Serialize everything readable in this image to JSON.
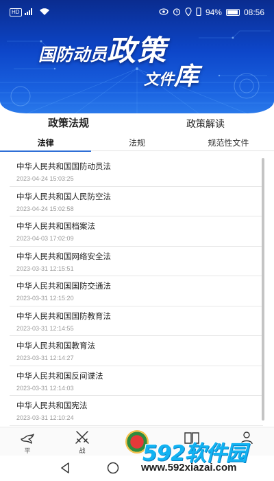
{
  "status_bar": {
    "network_left": "HD 4G",
    "battery": "94%",
    "time": "08:56"
  },
  "banner": {
    "title_line1_small": "国防动员",
    "title_line1_big": "政策",
    "title_line2_small": "文件",
    "title_line2_big": "库"
  },
  "main_tabs": [
    {
      "label": "政策法规",
      "active": true
    },
    {
      "label": "政策解读",
      "active": false
    }
  ],
  "sub_tabs": [
    {
      "label": "法律",
      "active": true
    },
    {
      "label": "法规",
      "active": false
    },
    {
      "label": "规范性文件",
      "active": false
    }
  ],
  "items": [
    {
      "title": "中华人民共和国国防动员法",
      "time": "2023-04-24 15:03:25"
    },
    {
      "title": "中华人民共和国人民防空法",
      "time": "2023-04-24 15:02:58"
    },
    {
      "title": "中华人民共和国档案法",
      "time": "2023-04-03 17:02:09"
    },
    {
      "title": "中华人民共和国网络安全法",
      "time": "2023-03-31 12:15:51"
    },
    {
      "title": "中华人民共和国国防交通法",
      "time": "2023-03-31 12:15:20"
    },
    {
      "title": "中华人民共和国国防教育法",
      "time": "2023-03-31 12:14:55"
    },
    {
      "title": "中华人民共和国教育法",
      "time": "2023-03-31 12:14:27"
    },
    {
      "title": "中华人民共和国反间谍法",
      "time": "2023-03-31 12:14:03"
    },
    {
      "title": "中华人民共和国宪法",
      "time": "2023-03-31 12:10:24"
    }
  ],
  "bottom_nav": [
    {
      "label": "平",
      "icon": "dove-icon"
    },
    {
      "label": "战",
      "icon": "crossed-swords-icon"
    },
    {
      "label": "",
      "icon": "emblem-icon"
    },
    {
      "label": "",
      "icon": "book-icon"
    },
    {
      "label": "",
      "icon": "user-icon"
    }
  ],
  "watermark": {
    "logo": "592软件园",
    "url": "www.592xiazai.com"
  },
  "colors": {
    "banner_blue": "#0d46c9",
    "tab_underline": "#2f6fd6",
    "watermark_blue": "#12b3f2"
  }
}
